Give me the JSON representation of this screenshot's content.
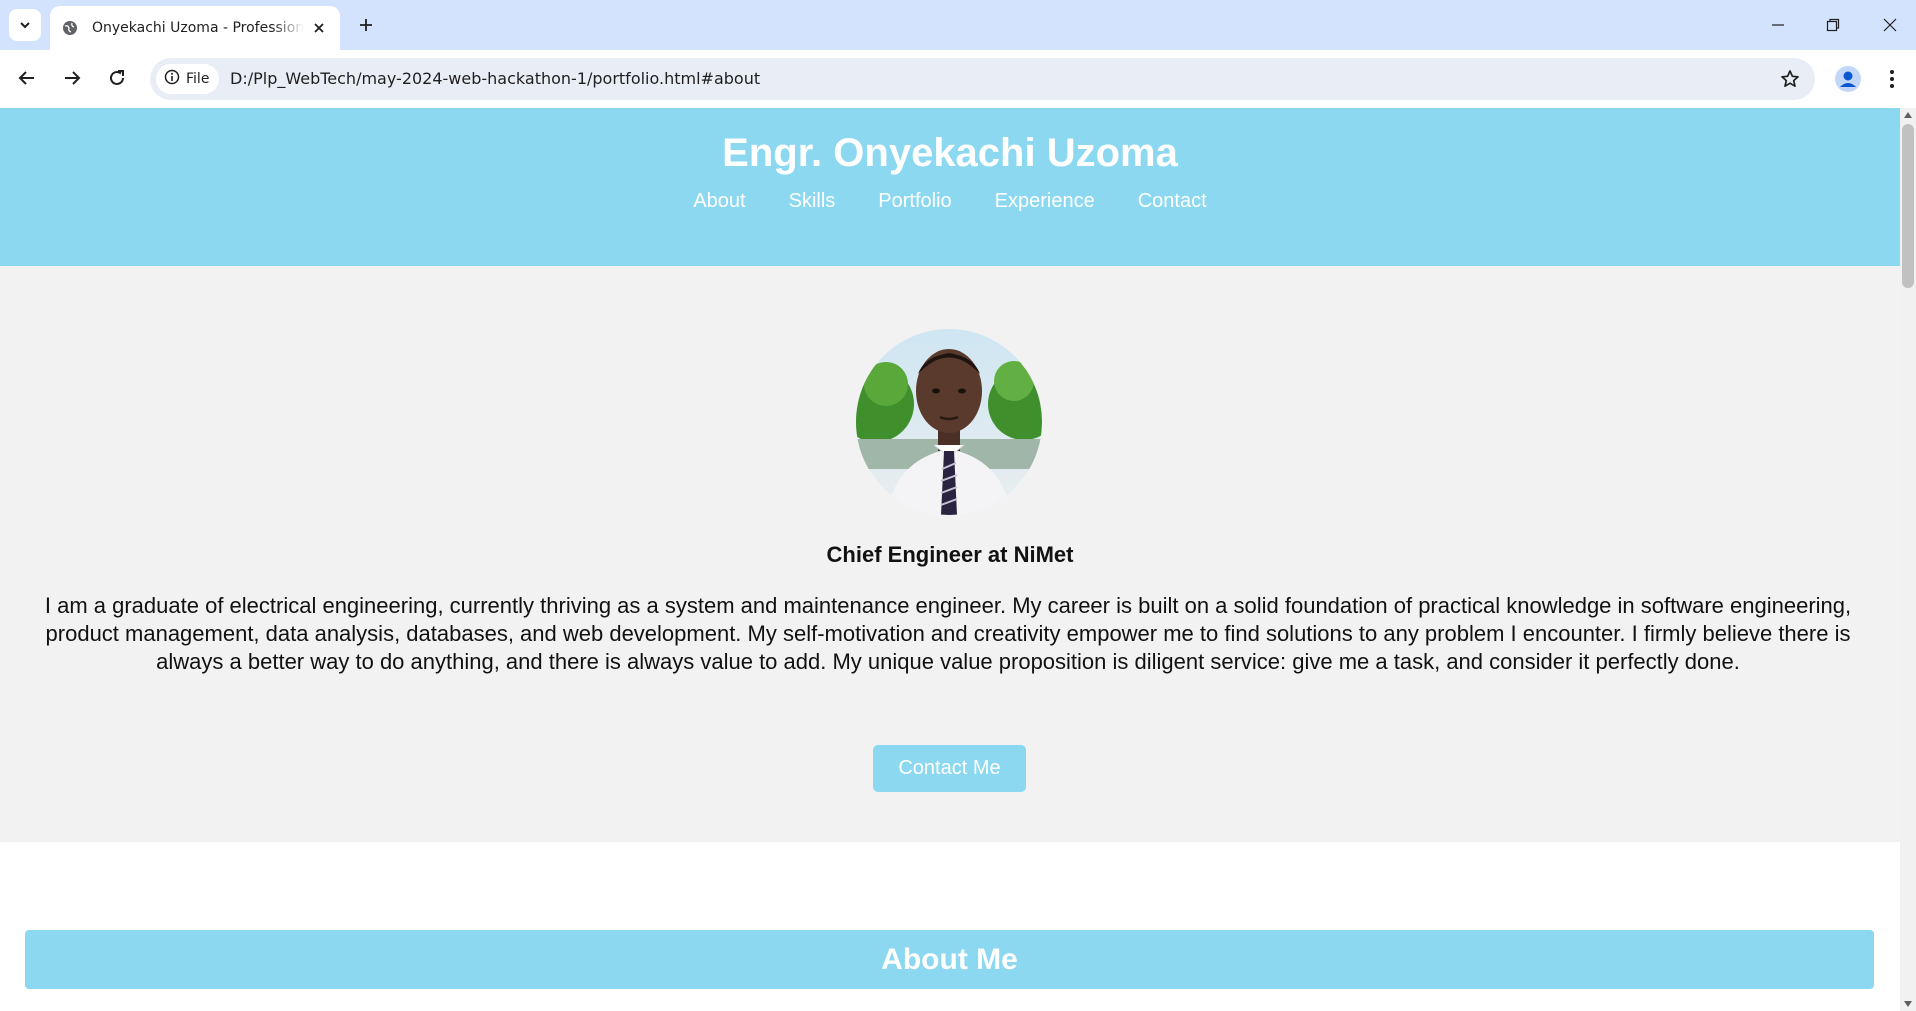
{
  "browser": {
    "tab_title": "Onyekachi Uzoma - Professional Portfolio",
    "site_chip_label": "File",
    "url": "D:/Plp_WebTech/may-2024-web-hackathon-1/portfolio.html#about",
    "icons": [
      "tab-search-icon",
      "globe-icon",
      "close-icon",
      "plus-icon",
      "minimize-icon",
      "restore-icon",
      "window-close-icon",
      "back-arrow-icon",
      "forward-arrow-icon",
      "reload-icon",
      "info-icon",
      "star-icon",
      "profile-icon",
      "more-vert-icon"
    ]
  },
  "header": {
    "title": "Engr. Onyekachi Uzoma",
    "nav": [
      {
        "label": "About"
      },
      {
        "label": "Skills"
      },
      {
        "label": "Portfolio"
      },
      {
        "label": "Experience"
      },
      {
        "label": "Contact"
      }
    ]
  },
  "hero": {
    "role": "Chief Engineer at NiMet",
    "bio": "I am a graduate of electrical engineering, currently thriving as a system and maintenance engineer. My career is built on a solid foundation of practical knowledge in software engineering, product management, data analysis, databases, and web development. My self-motivation and creativity empower me to find solutions to any problem I encounter. I firmly believe there is always a better way to do anything, and there is always value to add. My unique value proposition is diligent service: give me a task, and consider it perfectly done.",
    "contact_button": "Contact Me"
  },
  "about": {
    "heading": "About Me"
  },
  "colors": {
    "accent": "#8cd8f0",
    "hero_bg": "#f2f2f2",
    "chrome_bg": "#d3e3fd"
  }
}
